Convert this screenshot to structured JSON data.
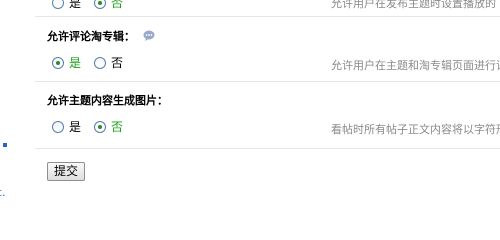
{
  "left_strip": {
    "link_text": "c."
  },
  "top_partial": {
    "option_yes": "是",
    "option_no": "否",
    "description": "允许用户在发布主题时设置播放的"
  },
  "settings": [
    {
      "title": "允许评论淘专辑：",
      "help_icon": "speech-bubble-icon",
      "option_yes": "是",
      "option_no": "否",
      "selected": "yes",
      "description": "允许用户在主题和淘专辑页面进行评"
    },
    {
      "title": "允许主题内容生成图片：",
      "option_yes": "是",
      "option_no": "否",
      "selected": "no",
      "description": "看帖时所有帖子正文内容将以字符形"
    }
  ],
  "submit_label": "提交",
  "colors": {
    "selected_label": "#19a119",
    "description": "#8a8a8a",
    "link": "#2b64c5"
  }
}
